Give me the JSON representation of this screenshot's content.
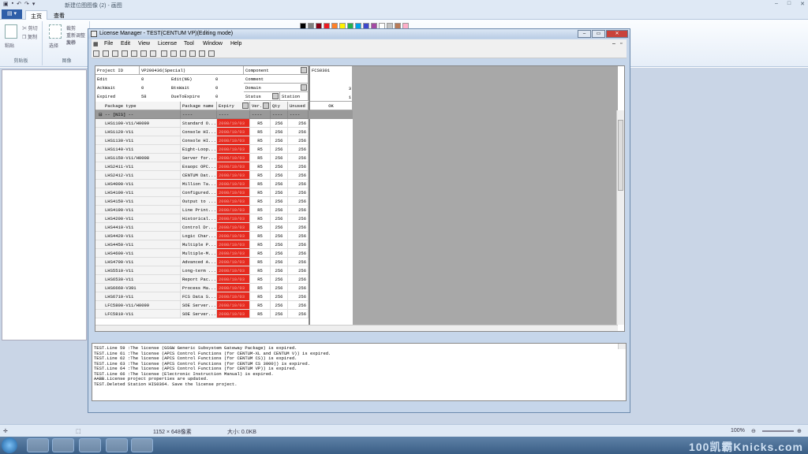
{
  "paint": {
    "title": "新建位图图像 (2) - 画图",
    "tabs": [
      "主页",
      "查看"
    ],
    "file_label": "",
    "clipboard": {
      "paste": "粘贴",
      "cut": "剪切",
      "copy": "复制",
      "group": "剪贴板"
    },
    "image": {
      "select": "选择",
      "crop": "裁剪",
      "resize": "重新调整大小",
      "rotate": "旋转",
      "group": "图像"
    },
    "status": {
      "dimensions": "1152 × 648像素",
      "size": "大小: 0.0KB",
      "zoom": "100%"
    },
    "palette": [
      "#000000",
      "#7f7f7f",
      "#880015",
      "#ed1c24",
      "#ff7f27",
      "#fff200",
      "#22b14c",
      "#00a2e8",
      "#3f48cc",
      "#a349a4",
      "#ffffff",
      "#c3c3c3",
      "#b97a57",
      "#ffaec9"
    ]
  },
  "taskbar": {
    "watermark": "100凯霸Knicks.com"
  },
  "lm": {
    "title": "License Manager - TEST(CENTUM VP)(Editing mode)",
    "menu": [
      "File",
      "Edit",
      "View",
      "License",
      "Tool",
      "Window",
      "Help"
    ],
    "fields": {
      "project_id_label": "Project ID",
      "project_id_value": "VP200436(Special)",
      "component_label": "Component",
      "comment_label": "Comment",
      "domain_label": "Domain",
      "status_label": "Status",
      "station_label": "Station",
      "edit_label": "Edit",
      "edit_value": "0",
      "editng_label": "Edit(NG)",
      "editng_value": "0",
      "ackwait_label": "AckWait",
      "ackwait_value": "0",
      "btswait_label": "BtsWait",
      "btswait_value": "0",
      "expired_label": "Expired",
      "expired_value": "58",
      "duetoexpire_label": "DueToExpire",
      "duetoexpire_value": "0",
      "station_name": "FCS0301",
      "val3": "3",
      "val1": "1",
      "ok": "OK",
      "dashes": "----"
    },
    "columns": {
      "package_type": "Package type",
      "package_name": "Package name",
      "expiry": "Expiry",
      "ver": "Ver.",
      "qty": "Qty",
      "unused": "Unused"
    },
    "group_row": {
      "name": "-- [NIS] --",
      "pkg": "----",
      "exp": "----",
      "ver": "----",
      "qty": "----",
      "unused": "----"
    },
    "rows": [
      {
        "type": "LHS1100-V11/H0099",
        "name": "Standard O...",
        "expiry": "2008/10/03",
        "ver": "R5",
        "qty": "256",
        "unused": "256"
      },
      {
        "type": "LHS1120-V11",
        "name": "Console HI...",
        "expiry": "2008/10/03",
        "ver": "R5",
        "qty": "256",
        "unused": "256"
      },
      {
        "type": "LHS1130-V11",
        "name": "Console HI...",
        "expiry": "2008/10/03",
        "ver": "R5",
        "qty": "256",
        "unused": "256"
      },
      {
        "type": "LHS1140-V11",
        "name": "Eight-Loop...",
        "expiry": "2008/10/03",
        "ver": "R5",
        "qty": "256",
        "unused": "256"
      },
      {
        "type": "LHS1150-V11/H0008",
        "name": "Server for...",
        "expiry": "2008/10/03",
        "ver": "R5",
        "qty": "256",
        "unused": "256"
      },
      {
        "type": "LHS2411-V11",
        "name": "Exaopc OPC...",
        "expiry": "2008/10/03",
        "ver": "R5",
        "qty": "256",
        "unused": "256"
      },
      {
        "type": "LHS2412-V11",
        "name": "CENTUM Dat...",
        "expiry": "2008/10/03",
        "ver": "R5",
        "qty": "256",
        "unused": "256"
      },
      {
        "type": "LHS4000-V11",
        "name": "Million Ta...",
        "expiry": "2008/10/03",
        "ver": "R5",
        "qty": "256",
        "unused": "256"
      },
      {
        "type": "LHS4100-V11",
        "name": "Configured...",
        "expiry": "2008/10/03",
        "ver": "R5",
        "qty": "256",
        "unused": "256"
      },
      {
        "type": "LHS4150-V11",
        "name": "Output to ...",
        "expiry": "2008/10/03",
        "ver": "R5",
        "qty": "256",
        "unused": "256"
      },
      {
        "type": "LHS4190-V11",
        "name": "Line Print...",
        "expiry": "2008/10/03",
        "ver": "R5",
        "qty": "256",
        "unused": "256"
      },
      {
        "type": "LHS4200-V11",
        "name": "Historical...",
        "expiry": "2008/10/03",
        "ver": "R5",
        "qty": "256",
        "unused": "256"
      },
      {
        "type": "LHS4410-V11",
        "name": "Control Dr...",
        "expiry": "2008/10/03",
        "ver": "R5",
        "qty": "256",
        "unused": "256"
      },
      {
        "type": "LHS4420-V11",
        "name": "Logic Char...",
        "expiry": "2008/10/03",
        "ver": "R5",
        "qty": "256",
        "unused": "256"
      },
      {
        "type": "LHS4450-V11",
        "name": "Multiple P...",
        "expiry": "2008/10/03",
        "ver": "R5",
        "qty": "256",
        "unused": "256"
      },
      {
        "type": "LHS4600-V11",
        "name": "Multiple-M...",
        "expiry": "2008/10/03",
        "ver": "R5",
        "qty": "256",
        "unused": "256"
      },
      {
        "type": "LHS4700-V11",
        "name": "Advanced A...",
        "expiry": "2008/10/03",
        "ver": "R5",
        "qty": "256",
        "unused": "256"
      },
      {
        "type": "LHS5510-V11",
        "name": "Long-term ...",
        "expiry": "2008/10/03",
        "ver": "R5",
        "qty": "256",
        "unused": "256"
      },
      {
        "type": "LHS6530-V11",
        "name": "Report Pac...",
        "expiry": "2008/10/03",
        "ver": "R5",
        "qty": "256",
        "unused": "256"
      },
      {
        "type": "LHS6660-V391",
        "name": "Process Ma...",
        "expiry": "2008/10/03",
        "ver": "R5",
        "qty": "256",
        "unused": "256"
      },
      {
        "type": "LHS6710-V11",
        "name": "FCS Data S...",
        "expiry": "2008/10/03",
        "ver": "R5",
        "qty": "256",
        "unused": "256"
      },
      {
        "type": "LFC5800-V11/H0099",
        "name": "SOE Server...",
        "expiry": "2008/10/03",
        "ver": "R5",
        "qty": "256",
        "unused": "256"
      },
      {
        "type": "LFC5810-V11",
        "name": "SOE Server...",
        "expiry": "2008/10/03",
        "ver": "R5",
        "qty": "256",
        "unused": "256"
      }
    ],
    "log": [
      "TEST.Line 59 :The license (GSGW Generic Subsystem Gateway Package) is expired.",
      "TEST.Line 61 :The license (APCS Control Functions (for CENTUM-XL and CENTUM V)) is expired.",
      "TEST.Line 62 :The license (APCS Control Functions (for CENTUM CS)) is expired.",
      "TEST.Line 63 :The license (APCS Control Functions (for CENTUM CS 3000)) is expired.",
      "TEST.Line 64 :The license (APCS Control Functions (for CENTUM VP)) is expired.",
      "TEST.Line 66 :The license (Electronic Instruction Manual) is expired.",
      "AABB.License project properties are updated.",
      "TEST.Deleted Station HIS0364. Save the license project."
    ]
  }
}
